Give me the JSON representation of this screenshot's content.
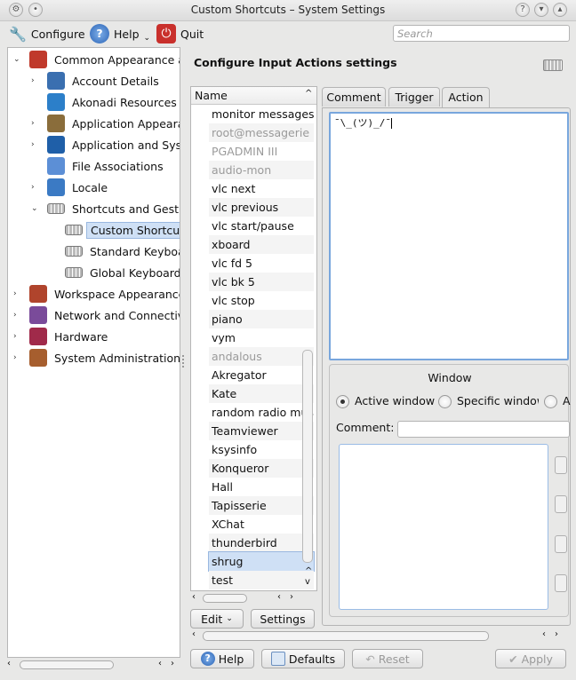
{
  "window": {
    "title": "Custom Shortcuts – System Settings"
  },
  "toolbar": {
    "configure": "Configure",
    "help": "Help",
    "quit": "Quit",
    "search_placeholder": "Search"
  },
  "tree": [
    {
      "label": "Common Appearance and Behavior",
      "level": 0,
      "arrow": "v"
    },
    {
      "label": "Account Details",
      "level": 1,
      "arrow": ">"
    },
    {
      "label": "Akonadi Resources Configuration",
      "level": 1,
      "arrow": ""
    },
    {
      "label": "Application Appearance",
      "level": 1,
      "arrow": ">"
    },
    {
      "label": "Application and System Notifications",
      "level": 1,
      "arrow": ">"
    },
    {
      "label": "File Associations",
      "level": 1,
      "arrow": ""
    },
    {
      "label": "Locale",
      "level": 1,
      "arrow": ">"
    },
    {
      "label": "Shortcuts and Gestures",
      "level": 1,
      "arrow": "v"
    },
    {
      "label": "Custom Shortcuts",
      "level": 2,
      "arrow": "",
      "selected": true
    },
    {
      "label": "Standard Keyboard Shortcuts",
      "level": 2,
      "arrow": ""
    },
    {
      "label": "Global Keyboard Shortcuts",
      "level": 2,
      "arrow": ""
    },
    {
      "label": "Workspace Appearance and Behavior",
      "level": 0,
      "arrow": ">"
    },
    {
      "label": "Network and Connectivity",
      "level": 0,
      "arrow": ">"
    },
    {
      "label": "Hardware",
      "level": 0,
      "arrow": ">"
    },
    {
      "label": "System Administration",
      "level": 0,
      "arrow": ">"
    }
  ],
  "panel": {
    "title": "Configure Input Actions settings"
  },
  "list": {
    "header": "Name",
    "items": [
      {
        "label": "monitor messages",
        "dim": false
      },
      {
        "label": "root@messagerie",
        "dim": true
      },
      {
        "label": "PGADMIN III",
        "dim": true
      },
      {
        "label": "audio-mon",
        "dim": true
      },
      {
        "label": "vlc next",
        "dim": false
      },
      {
        "label": "vlc previous",
        "dim": false
      },
      {
        "label": "vlc start/pause",
        "dim": false
      },
      {
        "label": "xboard",
        "dim": false
      },
      {
        "label": "vlc fd 5",
        "dim": false
      },
      {
        "label": "vlc bk 5",
        "dim": false
      },
      {
        "label": "vlc stop",
        "dim": false
      },
      {
        "label": "piano",
        "dim": false
      },
      {
        "label": "vym",
        "dim": false
      },
      {
        "label": "andalous",
        "dim": true
      },
      {
        "label": "Akregator",
        "dim": false
      },
      {
        "label": "Kate",
        "dim": false
      },
      {
        "label": "random radio music",
        "dim": false
      },
      {
        "label": "Teamviewer",
        "dim": false
      },
      {
        "label": "ksysinfo",
        "dim": false
      },
      {
        "label": "Konqueror",
        "dim": false
      },
      {
        "label": "Hall",
        "dim": false
      },
      {
        "label": "Tapisserie",
        "dim": false
      },
      {
        "label": "XChat",
        "dim": false
      },
      {
        "label": "thunderbird",
        "dim": false
      },
      {
        "label": "shrug",
        "dim": false,
        "selected": true
      },
      {
        "label": "test",
        "dim": false
      }
    ],
    "edit_button": "Edit",
    "settings_button": "Settings"
  },
  "tabs": {
    "comment": "Comment",
    "trigger": "Trigger",
    "action": "Action"
  },
  "action_text": "¯\\_(ツ)_/¯",
  "window_group": {
    "title": "Window",
    "active_window": "Active window",
    "specific_window": "Specific window",
    "cut_letter": "A",
    "comment_label": "Comment:"
  },
  "footer": {
    "help": "Help",
    "defaults": "Defaults",
    "reset": "Reset",
    "apply": "Apply"
  },
  "colors": {
    "selection": "#cfe0f5",
    "focus_border": "#78a6dd"
  }
}
